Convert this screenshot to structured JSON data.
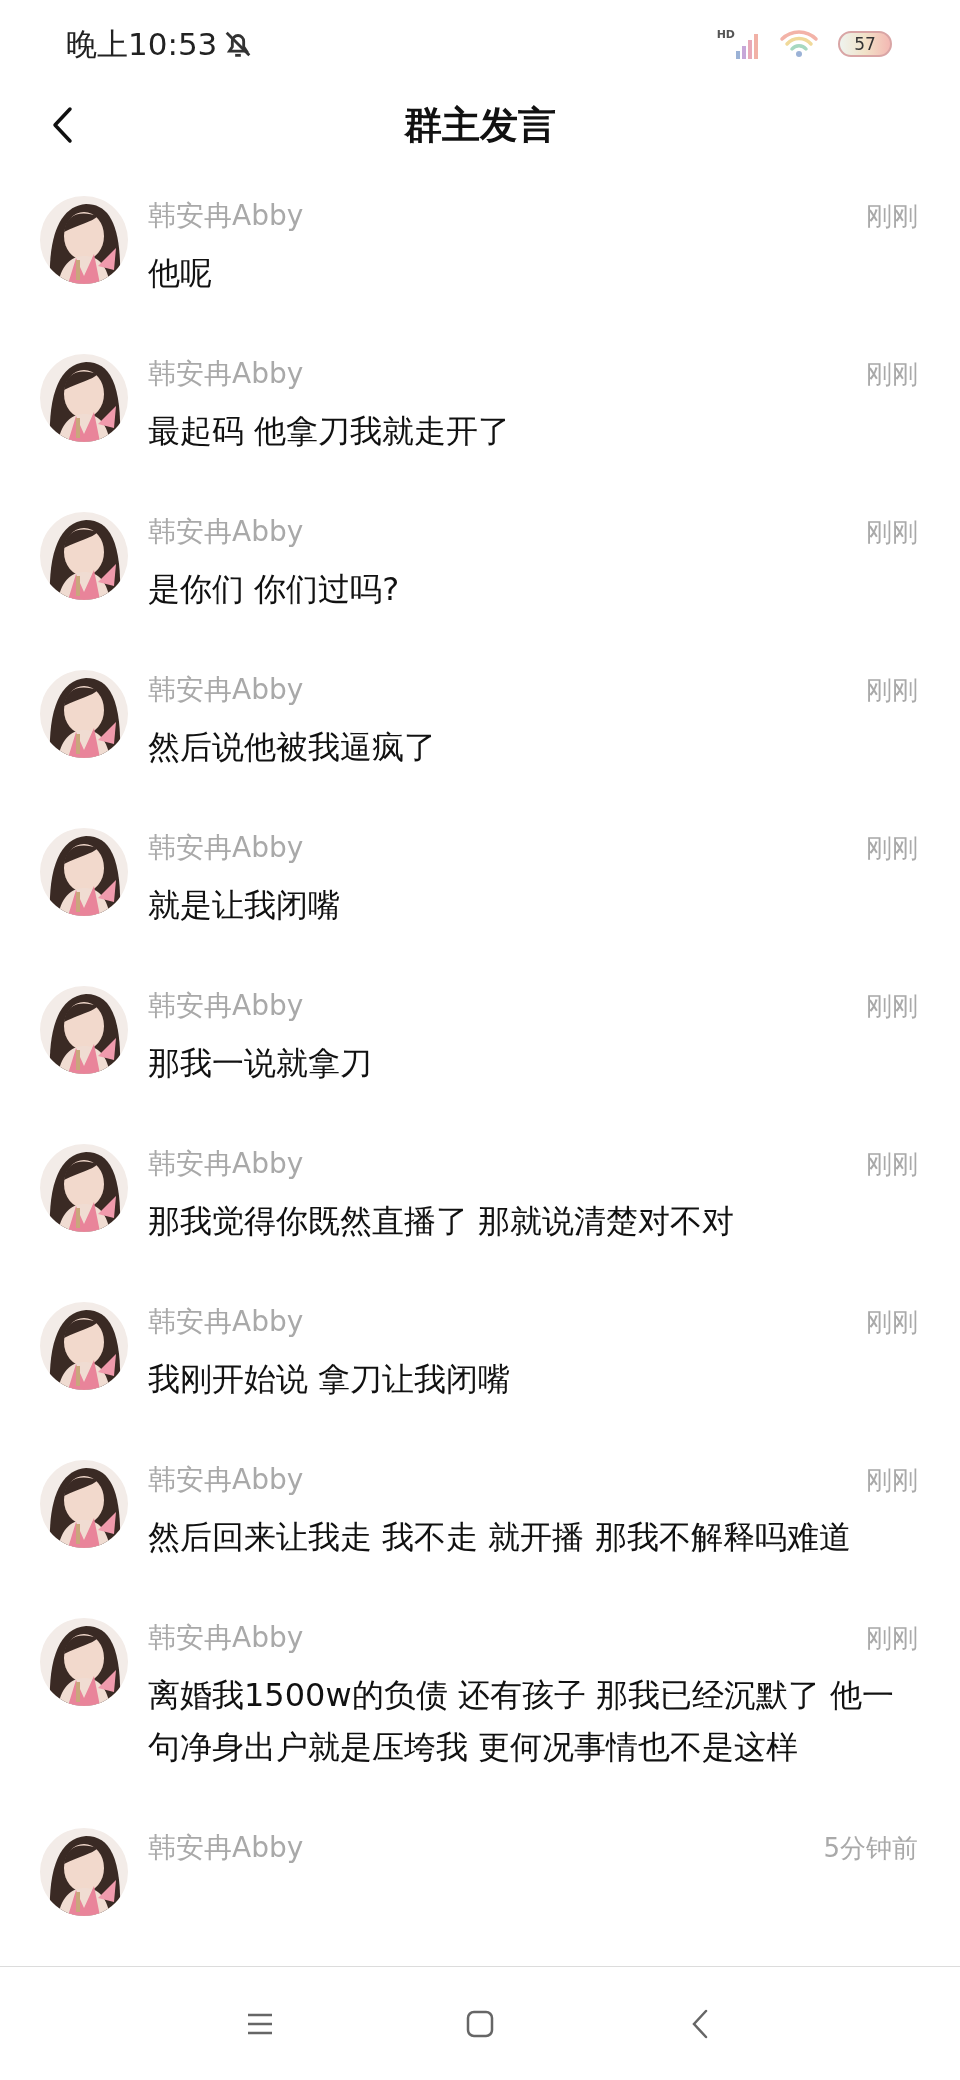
{
  "status_bar": {
    "time": "晚上10:53",
    "network_label": "HD",
    "battery": "57"
  },
  "header": {
    "title": "群主发言"
  },
  "messages": [
    {
      "sender": "韩安冉Abby",
      "time": "刚刚",
      "text": "他呢"
    },
    {
      "sender": "韩安冉Abby",
      "time": "刚刚",
      "text": "最起码 他拿刀我就走开了"
    },
    {
      "sender": "韩安冉Abby",
      "time": "刚刚",
      "text": "是你们 你们过吗?"
    },
    {
      "sender": "韩安冉Abby",
      "time": "刚刚",
      "text": "然后说他被我逼疯了"
    },
    {
      "sender": "韩安冉Abby",
      "time": "刚刚",
      "text": "就是让我闭嘴"
    },
    {
      "sender": "韩安冉Abby",
      "time": "刚刚",
      "text": "那我一说就拿刀"
    },
    {
      "sender": "韩安冉Abby",
      "time": "刚刚",
      "text": "那我觉得你既然直播了 那就说清楚对不对"
    },
    {
      "sender": "韩安冉Abby",
      "time": "刚刚",
      "text": "我刚开始说 拿刀让我闭嘴"
    },
    {
      "sender": "韩安冉Abby",
      "time": "刚刚",
      "text": "然后回来让我走 我不走 就开播 那我不解释吗难道"
    },
    {
      "sender": "韩安冉Abby",
      "time": "刚刚",
      "text": "离婚我1500w的负债 还有孩子 那我已经沉默了 他一句净身出户就是压垮我 更何况事情也不是这样"
    },
    {
      "sender": "韩安冉Abby",
      "time": "5分钟前"
    }
  ]
}
